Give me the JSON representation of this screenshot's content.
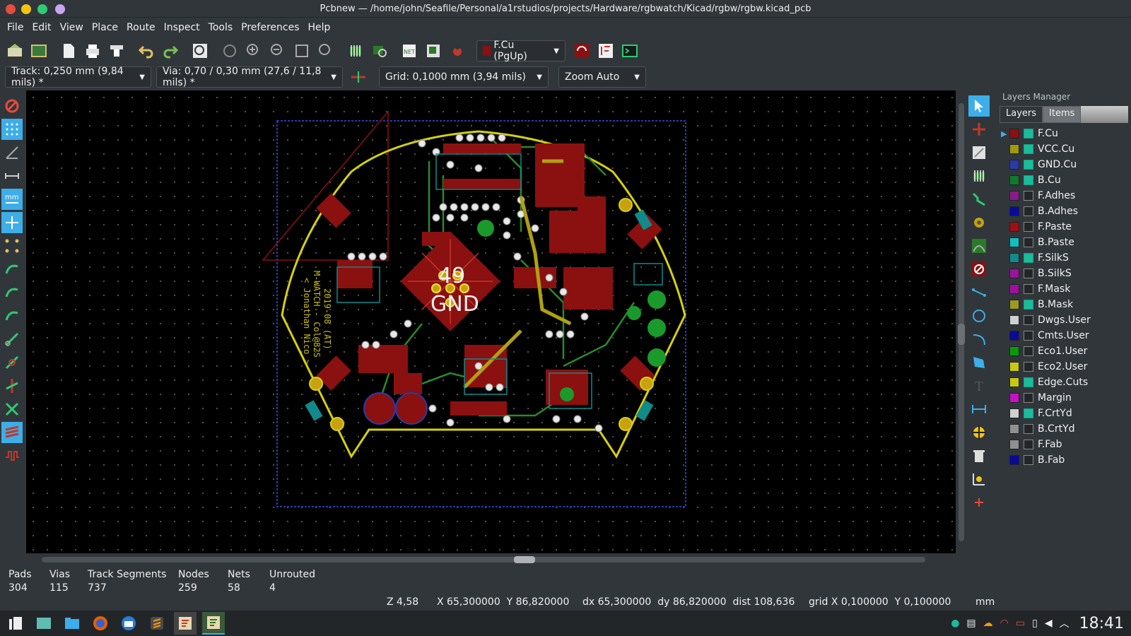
{
  "window": {
    "title": "Pcbnew — /home/john/Seafile/Personal/a1rstudios/projects/Hardware/rgbwatch/Kicad/rgbw/rgbw.kicad_pcb"
  },
  "menu": [
    "File",
    "Edit",
    "View",
    "Place",
    "Route",
    "Inspect",
    "Tools",
    "Preferences",
    "Help"
  ],
  "toolbar": {
    "layer_select": "F.Cu (PgUp)"
  },
  "toolbar2": {
    "track": "Track: 0,250 mm (9,84 mils) *",
    "via": "Via: 0,70 / 0,30 mm (27,6 / 11,8 mils) *",
    "grid": "Grid: 0,1000 mm (3,94 mils)",
    "zoom": "Zoom Auto"
  },
  "board": {
    "silk_big": "49",
    "silk_gnd": "GND",
    "vert_text_1": "M-WATCH - Col@82S",
    "vert_text_2": "< Jonathan Nico >",
    "vert_text_3": "2019-08 (AT)"
  },
  "layers_manager": {
    "title": "Layers Manager",
    "tabs": [
      "Layers",
      "Items"
    ],
    "layers": [
      {
        "name": "F.Cu",
        "color": "#8b1010",
        "checked": true,
        "active": true
      },
      {
        "name": "VCC.Cu",
        "color": "#a09a10",
        "checked": true
      },
      {
        "name": "GND.Cu",
        "color": "#2a3aa8",
        "checked": true
      },
      {
        "name": "B.Cu",
        "color": "#0f7a2a",
        "checked": true
      },
      {
        "name": "F.Adhes",
        "color": "#8a1a8a",
        "checked": false
      },
      {
        "name": "B.Adhes",
        "color": "#0a0aa0",
        "checked": false
      },
      {
        "name": "F.Paste",
        "color": "#a01010",
        "checked": false
      },
      {
        "name": "B.Paste",
        "color": "#10c0c0",
        "checked": false
      },
      {
        "name": "F.SilkS",
        "color": "#108a8a",
        "checked": true
      },
      {
        "name": "B.SilkS",
        "color": "#a010a0",
        "checked": false
      },
      {
        "name": "F.Mask",
        "color": "#a010a0",
        "checked": false
      },
      {
        "name": "B.Mask",
        "color": "#9a9a20",
        "checked": true
      },
      {
        "name": "Dwgs.User",
        "color": "#d0d0d0",
        "checked": false
      },
      {
        "name": "Cmts.User",
        "color": "#0a0a9a",
        "checked": false
      },
      {
        "name": "Eco1.User",
        "color": "#0a9a0a",
        "checked": false
      },
      {
        "name": "Eco2.User",
        "color": "#c8c810",
        "checked": false
      },
      {
        "name": "Edge.Cuts",
        "color": "#c8c810",
        "checked": true
      },
      {
        "name": "Margin",
        "color": "#c810c8",
        "checked": false
      },
      {
        "name": "F.CrtYd",
        "color": "#d0d0d0",
        "checked": true
      },
      {
        "name": "B.CrtYd",
        "color": "#909090",
        "checked": false
      },
      {
        "name": "F.Fab",
        "color": "#909090",
        "checked": false
      },
      {
        "name": "B.Fab",
        "color": "#0a0a9a",
        "checked": false
      }
    ]
  },
  "stats": [
    {
      "label": "Pads",
      "value": "304"
    },
    {
      "label": "Vias",
      "value": "115"
    },
    {
      "label": "Track Segments",
      "value": "737"
    },
    {
      "label": "Nodes",
      "value": "259"
    },
    {
      "label": "Nets",
      "value": "58"
    },
    {
      "label": "Unrouted",
      "value": "4"
    }
  ],
  "coords": {
    "zoom": "Z 4,58",
    "xy": "X 65,300000  Y 86,820000",
    "delta": "dx 65,300000  dy 86,820000  dist 108,636",
    "grid": "grid X 0,100000  Y 0,100000",
    "units": "mm"
  },
  "taskbar": {
    "clock": "18:41"
  }
}
